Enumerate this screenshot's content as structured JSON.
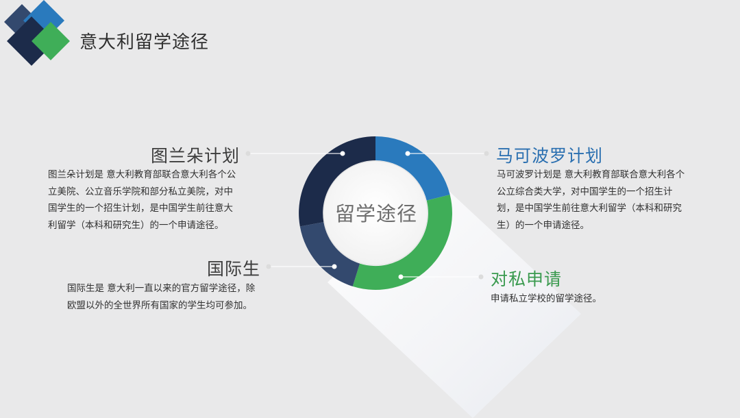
{
  "title": "意大利留学途径",
  "center_label": "留学途径",
  "colors": {
    "navy": "#1c2b4a",
    "steel": "#33496e",
    "blue": "#2a7abd",
    "green": "#3fae58",
    "heading_gray": "#3c3c3c",
    "heading_blue": "#2a6fb0",
    "heading_green": "#3a9a4f"
  },
  "routes": [
    {
      "heading": "图兰朵计划",
      "description": "图兰朵计划是 意大利教育部联合意大利各个公立美院、公立音乐学院和部分私立美院，对中国学生的一个招生计划，是中国学生前往意大利留学（本科和研究生）的一个申请途径。"
    },
    {
      "heading": "马可波罗计划",
      "description": "马可波罗计划是 意大利教育部联合意大利各个公立综合类大学，对中国学生的一个招生计划，是中国学生前往意大利留学（本科和研究生）的一个申请途径。"
    },
    {
      "heading": "国际生",
      "description": "国际生是 意大利一直以来的官方留学途径，除欧盟以外的全世界所有国家的学生均可参加。"
    },
    {
      "heading": "对私申请",
      "description": "申请私立学校的留学途径。"
    }
  ]
}
